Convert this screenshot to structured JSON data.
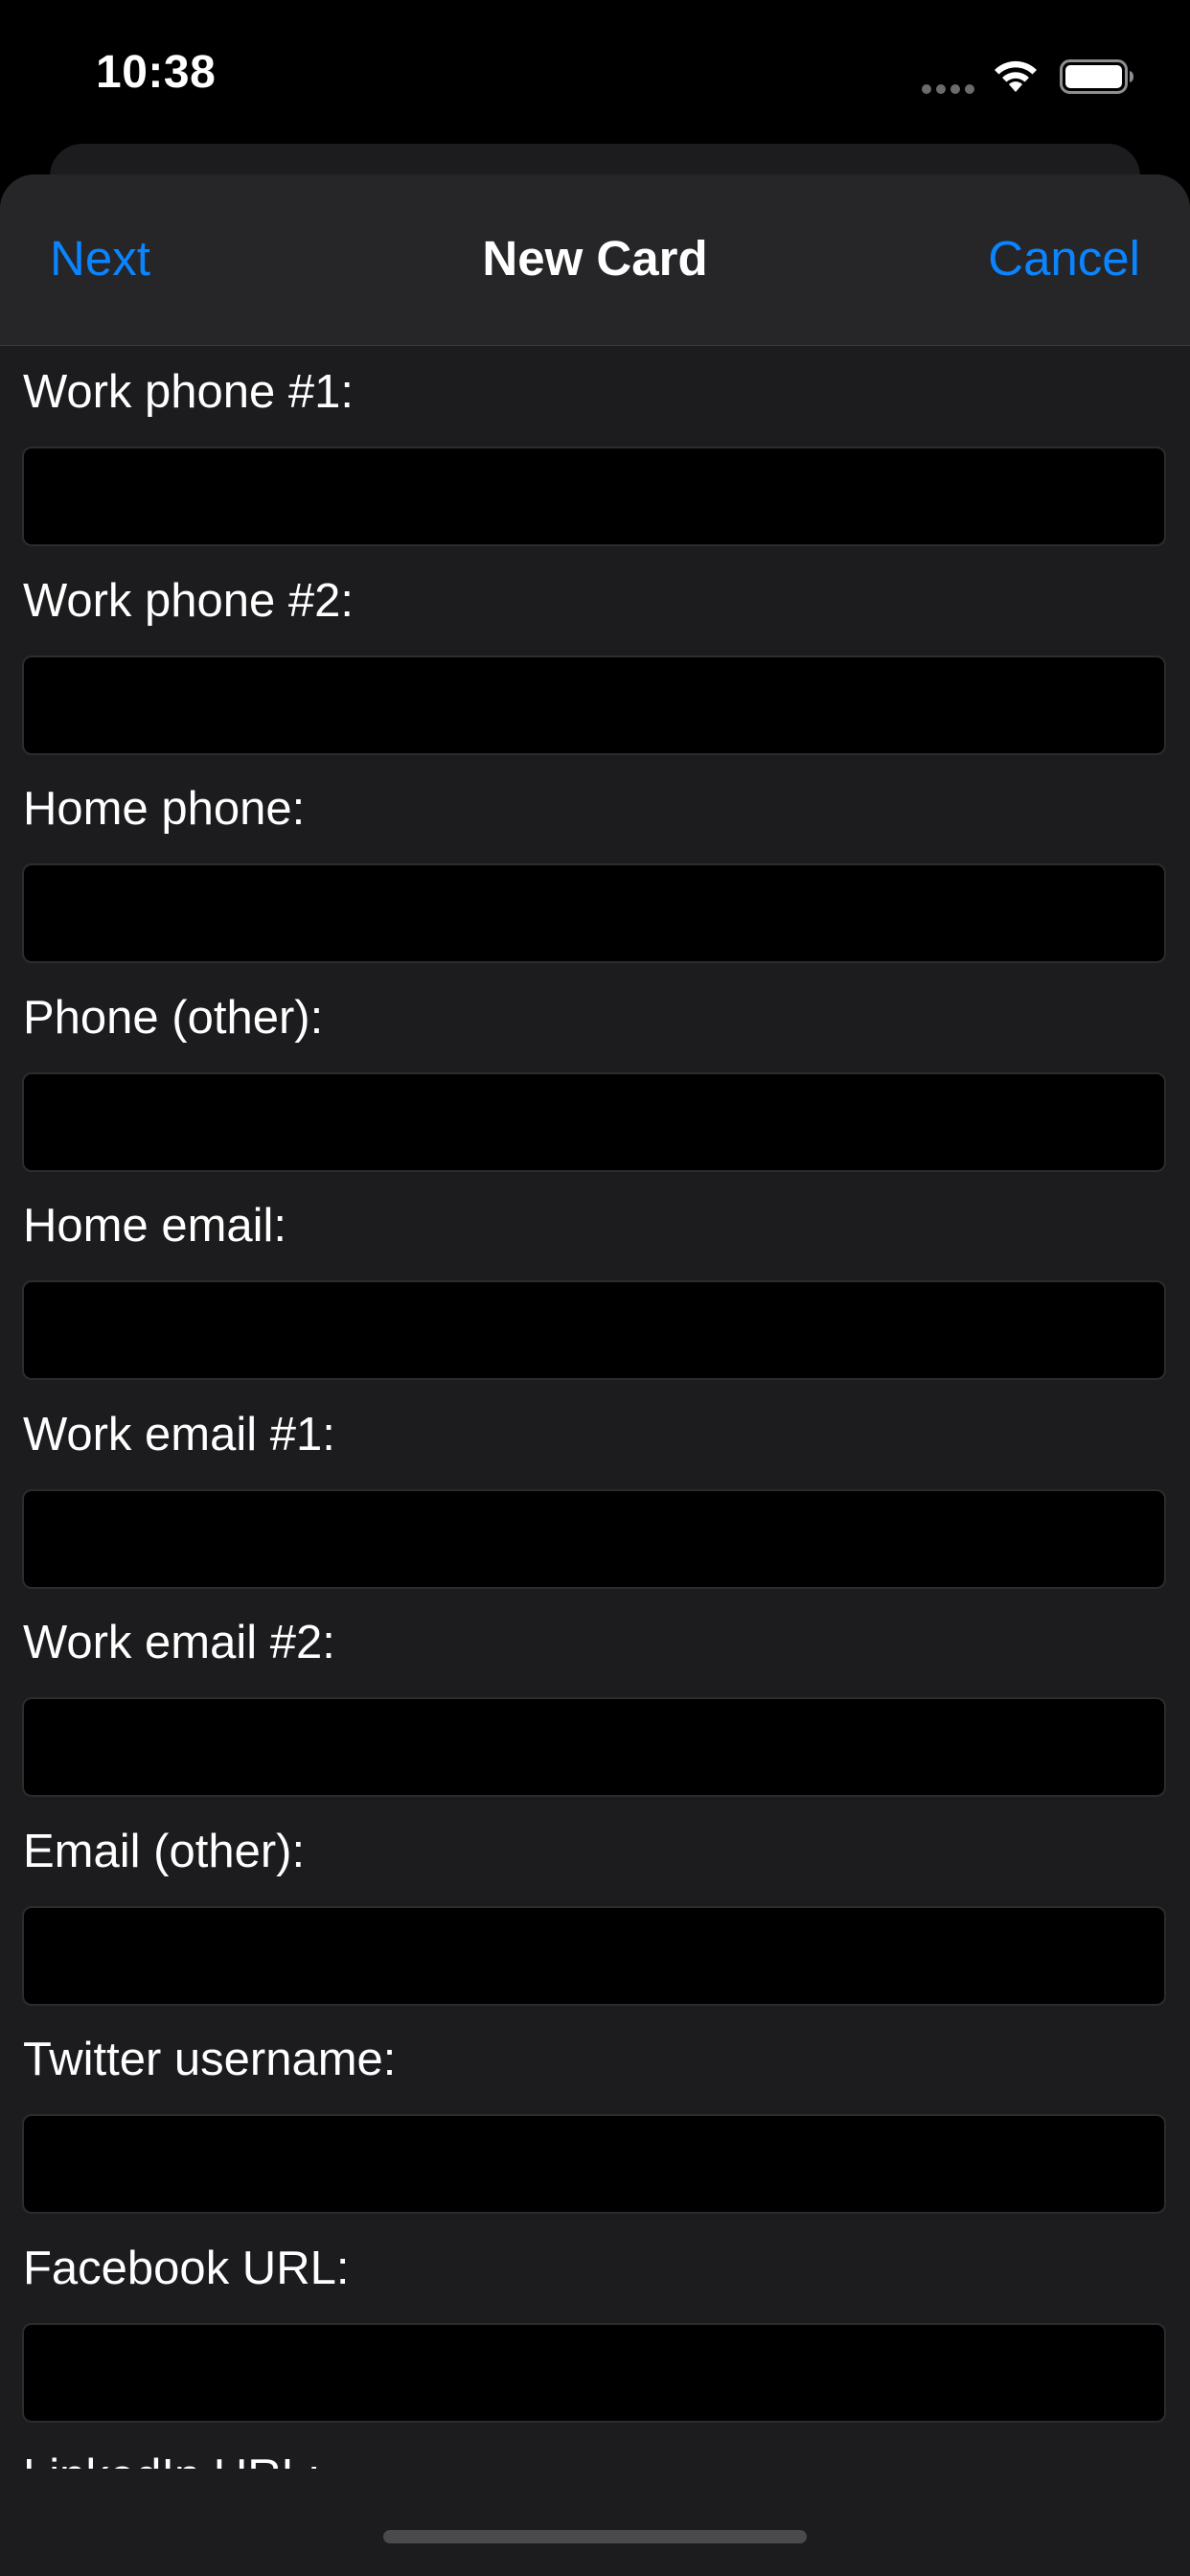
{
  "status_bar": {
    "time": "10:38",
    "icons": [
      "cellular-dots-icon",
      "wifi-icon",
      "battery-icon"
    ]
  },
  "nav": {
    "left_label": "Next",
    "title": "New Card",
    "right_label": "Cancel"
  },
  "form": {
    "fields": [
      {
        "label": "Work phone #1:",
        "value": "",
        "placeholder": ""
      },
      {
        "label": "Work phone #2:",
        "value": "",
        "placeholder": ""
      },
      {
        "label": "Home phone:",
        "value": "",
        "placeholder": ""
      },
      {
        "label": "Phone (other):",
        "value": "",
        "placeholder": ""
      },
      {
        "label": "Home email:",
        "value": "",
        "placeholder": ""
      },
      {
        "label": "Work email #1:",
        "value": "",
        "placeholder": ""
      },
      {
        "label": "Work email #2:",
        "value": "",
        "placeholder": ""
      },
      {
        "label": "Email (other):",
        "value": "",
        "placeholder": ""
      },
      {
        "label": "Twitter username:",
        "value": "",
        "placeholder": ""
      },
      {
        "label": "Facebook URL:",
        "value": "",
        "placeholder": ""
      },
      {
        "label": "LinkedIn URL:",
        "value": "",
        "placeholder": ""
      }
    ]
  },
  "colors": {
    "accent": "#0a84ff",
    "sheet_background": "#1c1c1e",
    "nav_background": "#262628",
    "input_background": "#000000"
  }
}
